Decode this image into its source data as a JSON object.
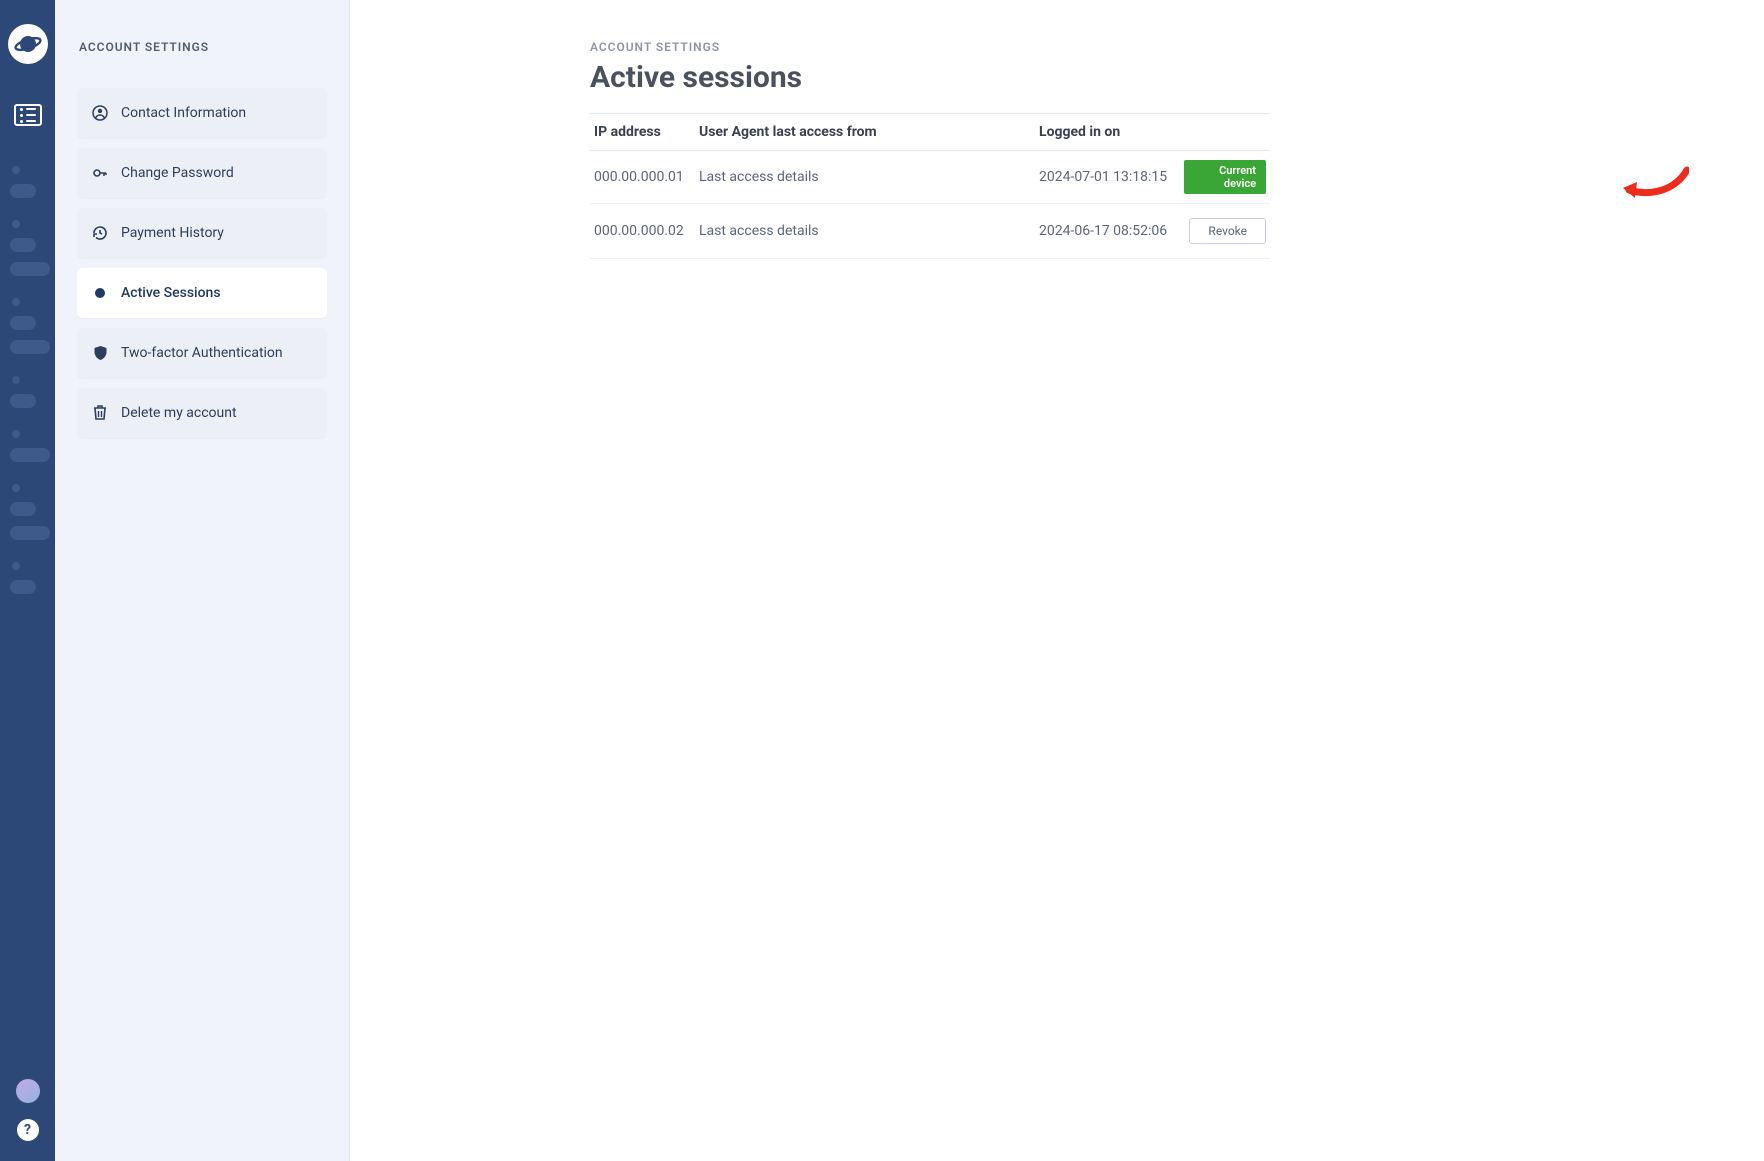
{
  "sidebar": {
    "heading": "ACCOUNT SETTINGS",
    "items": [
      {
        "icon": "user-circle-icon",
        "label": "Contact Information"
      },
      {
        "icon": "key-icon",
        "label": "Change Password"
      },
      {
        "icon": "history-icon",
        "label": "Payment History"
      },
      {
        "icon": "dot-icon",
        "label": "Active Sessions",
        "active": true
      },
      {
        "icon": "shield-icon",
        "label": "Two-factor Authentication"
      },
      {
        "icon": "trash-icon",
        "label": "Delete my account"
      }
    ]
  },
  "main": {
    "breadcrumb": "ACCOUNT SETTINGS",
    "title": "Active sessions",
    "table": {
      "headers": {
        "ip": "IP address",
        "ua": "User Agent last access from",
        "login": "Logged in on"
      },
      "rows": [
        {
          "ip": "000.00.000.01",
          "ua": "Last access details",
          "login": "2024-07-01 13:18:15",
          "current": true,
          "action_label": "Current device"
        },
        {
          "ip": "000.00.000.02",
          "ua": "Last access details",
          "login": "2024-06-17 08:52:06",
          "current": false,
          "action_label": "Revoke"
        }
      ]
    }
  }
}
